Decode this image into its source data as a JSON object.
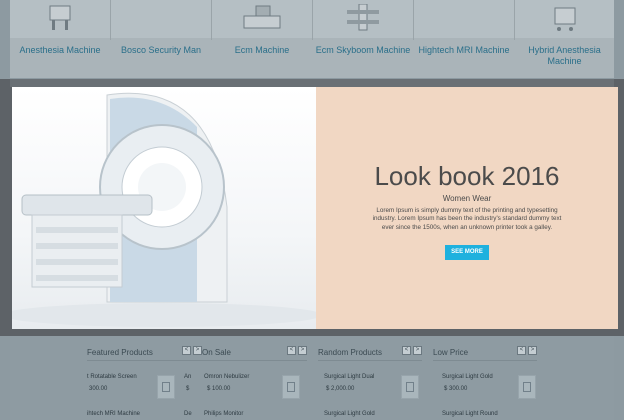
{
  "products_strip": [
    {
      "name": "Anesthesia Machine"
    },
    {
      "name": "Bosco Security Man"
    },
    {
      "name": "Ecm Machine"
    },
    {
      "name": "Ecm Skyboom Machine"
    },
    {
      "name": "Hightech MRI Machine"
    },
    {
      "name": "Hybrid Anesthesia Machine"
    }
  ],
  "modal": {
    "title": "Look book 2016",
    "subtitle": "Women Wear",
    "description": "Lorem Ipsum is simply dummy text of the printing and typesetting industry. Lorem Ipsum has been the industry's standard dummy text ever since the 1500s, when an unknown printer took a galley.",
    "button": "SEE MORE",
    "colors": {
      "pane": "#f1d7c3",
      "button": "#1fb1de"
    }
  },
  "sections": [
    {
      "title": "Featured Products",
      "prev": "<",
      "next": ">",
      "items": [
        {
          "name": "t Rotatable Screen",
          "price": "300.00"
        },
        {
          "name": "ihtech MRI Machine",
          "price": ""
        }
      ]
    },
    {
      "title": "On Sale",
      "prev": "<",
      "next": ">",
      "items": [
        {
          "name": "Omron Nebulizer",
          "price": "$ 100.00"
        },
        {
          "name": "Philips Monitor",
          "price": ""
        }
      ],
      "left_fragments": [
        "An",
        "$",
        "De"
      ]
    },
    {
      "title": "Random Products",
      "prev": "<",
      "next": ">",
      "items": [
        {
          "name": "Surgical Light Dual",
          "price": "$ 2,000.00"
        },
        {
          "name": "Surgical Light Gold",
          "price": ""
        }
      ]
    },
    {
      "title": "Low Price",
      "prev": "<",
      "next": ">",
      "items": [
        {
          "name": "Surgical Light Gold",
          "price": "$ 300.00"
        },
        {
          "name": "Surgical Light Round",
          "price": ""
        }
      ]
    }
  ]
}
